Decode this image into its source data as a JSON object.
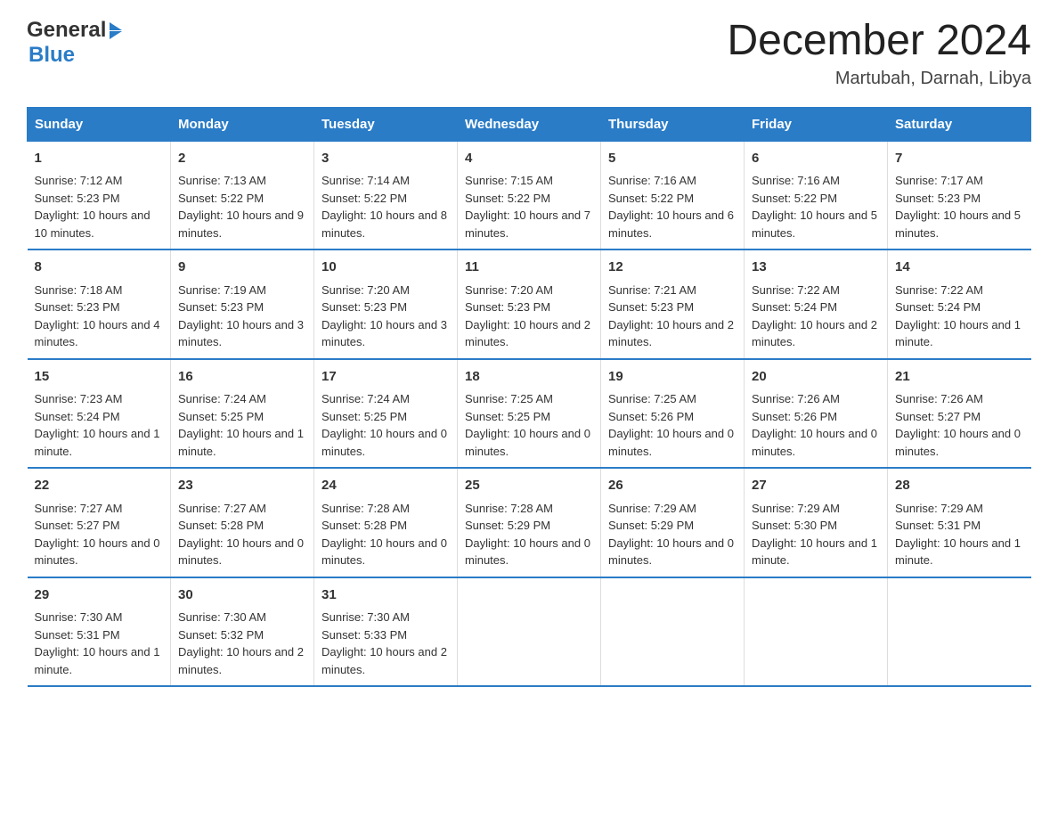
{
  "header": {
    "logo_general": "General",
    "logo_blue": "Blue",
    "month_title": "December 2024",
    "location": "Martubah, Darnah, Libya"
  },
  "days_of_week": [
    "Sunday",
    "Monday",
    "Tuesday",
    "Wednesday",
    "Thursday",
    "Friday",
    "Saturday"
  ],
  "weeks": [
    [
      {
        "day": "1",
        "sunrise": "Sunrise: 7:12 AM",
        "sunset": "Sunset: 5:23 PM",
        "daylight": "Daylight: 10 hours and 10 minutes."
      },
      {
        "day": "2",
        "sunrise": "Sunrise: 7:13 AM",
        "sunset": "Sunset: 5:22 PM",
        "daylight": "Daylight: 10 hours and 9 minutes."
      },
      {
        "day": "3",
        "sunrise": "Sunrise: 7:14 AM",
        "sunset": "Sunset: 5:22 PM",
        "daylight": "Daylight: 10 hours and 8 minutes."
      },
      {
        "day": "4",
        "sunrise": "Sunrise: 7:15 AM",
        "sunset": "Sunset: 5:22 PM",
        "daylight": "Daylight: 10 hours and 7 minutes."
      },
      {
        "day": "5",
        "sunrise": "Sunrise: 7:16 AM",
        "sunset": "Sunset: 5:22 PM",
        "daylight": "Daylight: 10 hours and 6 minutes."
      },
      {
        "day": "6",
        "sunrise": "Sunrise: 7:16 AM",
        "sunset": "Sunset: 5:22 PM",
        "daylight": "Daylight: 10 hours and 5 minutes."
      },
      {
        "day": "7",
        "sunrise": "Sunrise: 7:17 AM",
        "sunset": "Sunset: 5:23 PM",
        "daylight": "Daylight: 10 hours and 5 minutes."
      }
    ],
    [
      {
        "day": "8",
        "sunrise": "Sunrise: 7:18 AM",
        "sunset": "Sunset: 5:23 PM",
        "daylight": "Daylight: 10 hours and 4 minutes."
      },
      {
        "day": "9",
        "sunrise": "Sunrise: 7:19 AM",
        "sunset": "Sunset: 5:23 PM",
        "daylight": "Daylight: 10 hours and 3 minutes."
      },
      {
        "day": "10",
        "sunrise": "Sunrise: 7:20 AM",
        "sunset": "Sunset: 5:23 PM",
        "daylight": "Daylight: 10 hours and 3 minutes."
      },
      {
        "day": "11",
        "sunrise": "Sunrise: 7:20 AM",
        "sunset": "Sunset: 5:23 PM",
        "daylight": "Daylight: 10 hours and 2 minutes."
      },
      {
        "day": "12",
        "sunrise": "Sunrise: 7:21 AM",
        "sunset": "Sunset: 5:23 PM",
        "daylight": "Daylight: 10 hours and 2 minutes."
      },
      {
        "day": "13",
        "sunrise": "Sunrise: 7:22 AM",
        "sunset": "Sunset: 5:24 PM",
        "daylight": "Daylight: 10 hours and 2 minutes."
      },
      {
        "day": "14",
        "sunrise": "Sunrise: 7:22 AM",
        "sunset": "Sunset: 5:24 PM",
        "daylight": "Daylight: 10 hours and 1 minute."
      }
    ],
    [
      {
        "day": "15",
        "sunrise": "Sunrise: 7:23 AM",
        "sunset": "Sunset: 5:24 PM",
        "daylight": "Daylight: 10 hours and 1 minute."
      },
      {
        "day": "16",
        "sunrise": "Sunrise: 7:24 AM",
        "sunset": "Sunset: 5:25 PM",
        "daylight": "Daylight: 10 hours and 1 minute."
      },
      {
        "day": "17",
        "sunrise": "Sunrise: 7:24 AM",
        "sunset": "Sunset: 5:25 PM",
        "daylight": "Daylight: 10 hours and 0 minutes."
      },
      {
        "day": "18",
        "sunrise": "Sunrise: 7:25 AM",
        "sunset": "Sunset: 5:25 PM",
        "daylight": "Daylight: 10 hours and 0 minutes."
      },
      {
        "day": "19",
        "sunrise": "Sunrise: 7:25 AM",
        "sunset": "Sunset: 5:26 PM",
        "daylight": "Daylight: 10 hours and 0 minutes."
      },
      {
        "day": "20",
        "sunrise": "Sunrise: 7:26 AM",
        "sunset": "Sunset: 5:26 PM",
        "daylight": "Daylight: 10 hours and 0 minutes."
      },
      {
        "day": "21",
        "sunrise": "Sunrise: 7:26 AM",
        "sunset": "Sunset: 5:27 PM",
        "daylight": "Daylight: 10 hours and 0 minutes."
      }
    ],
    [
      {
        "day": "22",
        "sunrise": "Sunrise: 7:27 AM",
        "sunset": "Sunset: 5:27 PM",
        "daylight": "Daylight: 10 hours and 0 minutes."
      },
      {
        "day": "23",
        "sunrise": "Sunrise: 7:27 AM",
        "sunset": "Sunset: 5:28 PM",
        "daylight": "Daylight: 10 hours and 0 minutes."
      },
      {
        "day": "24",
        "sunrise": "Sunrise: 7:28 AM",
        "sunset": "Sunset: 5:28 PM",
        "daylight": "Daylight: 10 hours and 0 minutes."
      },
      {
        "day": "25",
        "sunrise": "Sunrise: 7:28 AM",
        "sunset": "Sunset: 5:29 PM",
        "daylight": "Daylight: 10 hours and 0 minutes."
      },
      {
        "day": "26",
        "sunrise": "Sunrise: 7:29 AM",
        "sunset": "Sunset: 5:29 PM",
        "daylight": "Daylight: 10 hours and 0 minutes."
      },
      {
        "day": "27",
        "sunrise": "Sunrise: 7:29 AM",
        "sunset": "Sunset: 5:30 PM",
        "daylight": "Daylight: 10 hours and 1 minute."
      },
      {
        "day": "28",
        "sunrise": "Sunrise: 7:29 AM",
        "sunset": "Sunset: 5:31 PM",
        "daylight": "Daylight: 10 hours and 1 minute."
      }
    ],
    [
      {
        "day": "29",
        "sunrise": "Sunrise: 7:30 AM",
        "sunset": "Sunset: 5:31 PM",
        "daylight": "Daylight: 10 hours and 1 minute."
      },
      {
        "day": "30",
        "sunrise": "Sunrise: 7:30 AM",
        "sunset": "Sunset: 5:32 PM",
        "daylight": "Daylight: 10 hours and 2 minutes."
      },
      {
        "day": "31",
        "sunrise": "Sunrise: 7:30 AM",
        "sunset": "Sunset: 5:33 PM",
        "daylight": "Daylight: 10 hours and 2 minutes."
      },
      {
        "day": "",
        "sunrise": "",
        "sunset": "",
        "daylight": ""
      },
      {
        "day": "",
        "sunrise": "",
        "sunset": "",
        "daylight": ""
      },
      {
        "day": "",
        "sunrise": "",
        "sunset": "",
        "daylight": ""
      },
      {
        "day": "",
        "sunrise": "",
        "sunset": "",
        "daylight": ""
      }
    ]
  ]
}
